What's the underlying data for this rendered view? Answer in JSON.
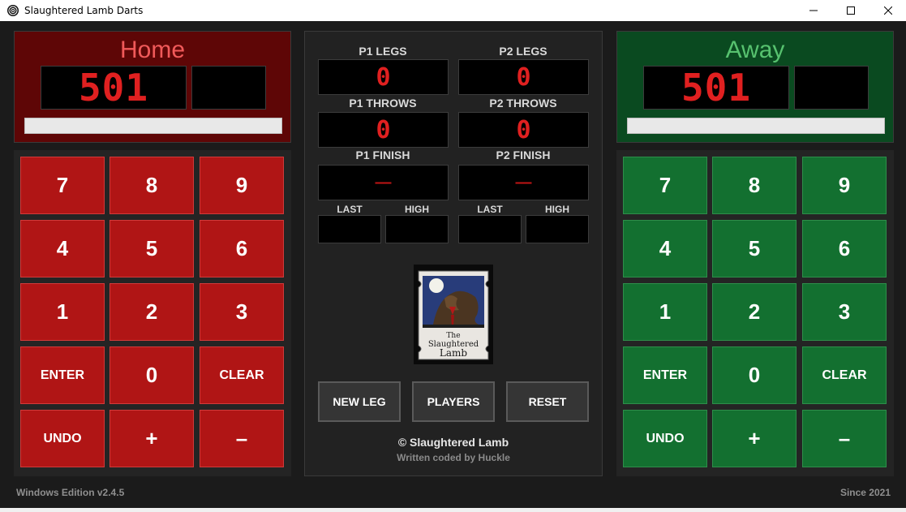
{
  "window": {
    "title": "Slaughtered Lamb Darts"
  },
  "home": {
    "name": "Home",
    "score": "501",
    "color": "#b01515"
  },
  "away": {
    "name": "Away",
    "score": "501",
    "color": "#137030"
  },
  "keypad": {
    "keys": [
      "7",
      "8",
      "9",
      "4",
      "5",
      "6",
      "1",
      "2",
      "3",
      "ENTER",
      "0",
      "CLEAR",
      "UNDO",
      "+",
      "–"
    ]
  },
  "stats": {
    "p1_legs_label": "P1 LEGS",
    "p1_legs": "0",
    "p2_legs_label": "P2 LEGS",
    "p2_legs": "0",
    "p1_throws_label": "P1 THROWS",
    "p1_throws": "0",
    "p2_throws_label": "P2 THROWS",
    "p2_throws": "0",
    "p1_finish_label": "P1 FINISH",
    "p1_finish": "—",
    "p2_finish_label": "P2 FINISH",
    "p2_finish": "—",
    "last_label": "LAST",
    "high_label": "HIGH"
  },
  "logo": {
    "line1": "The",
    "line2": "Slaughtered",
    "line3": "Lamb"
  },
  "buttons": {
    "new_leg": "NEW LEG",
    "players": "PLAYERS",
    "reset": "RESET"
  },
  "copyright": "© Slaughtered Lamb",
  "credit": "Written  coded by Huckle",
  "footer": {
    "edition": "Windows Edition v2.4.5",
    "since": "Since 2021"
  }
}
